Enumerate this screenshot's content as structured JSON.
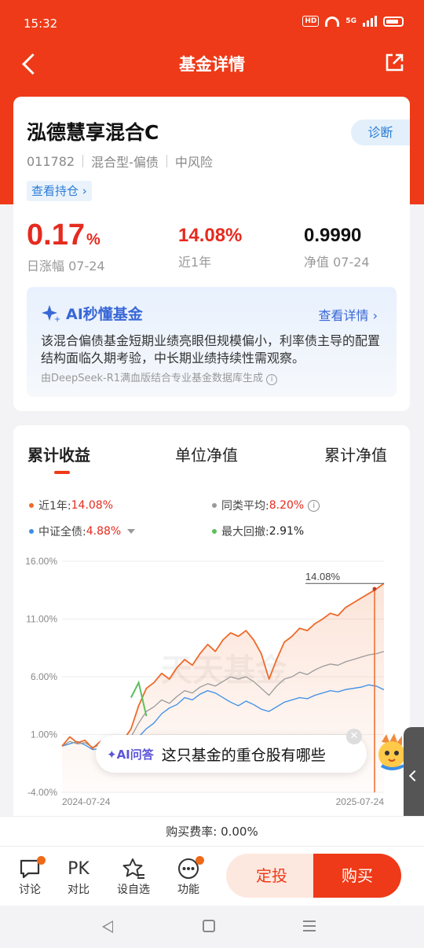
{
  "status": {
    "time": "15:32",
    "hd": "HD",
    "net": "5G"
  },
  "nav": {
    "title": "基金详情"
  },
  "fund": {
    "name": "泓德慧享混合C",
    "diagnose_label": "诊断",
    "code": "011782",
    "type": "混合型-偏债",
    "risk": "中风险",
    "holdings_label": "查看持仓 ›",
    "daily_change_value": "0.17",
    "daily_change_unit": "%",
    "daily_change_label": "日涨幅 07-24",
    "yearly_return_value": "14.08%",
    "yearly_return_label": "近1年",
    "nav_value": "0.9990",
    "nav_label": "净值 07-24"
  },
  "ai": {
    "title": "AI秒懂基金",
    "more_label": "查看详情",
    "text": "该混合偏债基金短期业绩亮眼但规模偏小，利率债主导的配置结构面临久期考验，中长期业绩持续性需观察。",
    "source": "由DeepSeek-R1满血版结合专业基金数据库生成"
  },
  "tabs": [
    "累计收益",
    "单位净值",
    "累计净值"
  ],
  "legend": [
    {
      "name": "近1年:",
      "value": "14.08%",
      "color": "#ee6a2a"
    },
    {
      "name": "同类平均:",
      "value": "8.20%",
      "color": "#999999"
    },
    {
      "name": "中证全债:",
      "value": "4.88%",
      "color": "#3a8ee6"
    },
    {
      "name": "最大回撤:",
      "value": "2.91%",
      "color": "#5cc05c"
    }
  ],
  "chart_data": {
    "type": "line",
    "x_start": "2024-07-24",
    "x_end": "2025-07-24",
    "y_ticks": [
      "16.00%",
      "11.00%",
      "6.00%",
      "1.00%",
      "-4.00%"
    ],
    "ylim": [
      -4,
      16
    ],
    "end_label": "14.08%",
    "watermark": "天天基金",
    "series": [
      {
        "name": "近1年",
        "color": "#ee6a2a",
        "values": [
          0.0,
          0.8,
          0.3,
          0.5,
          -0.2,
          0.4,
          0.1,
          -0.3,
          0.5,
          1.5,
          3.5,
          5.0,
          5.5,
          6.3,
          5.8,
          6.8,
          7.5,
          7.0,
          8.0,
          8.8,
          8.2,
          9.2,
          9.8,
          9.5,
          10.0,
          9.2,
          8.0,
          5.8,
          7.5,
          9.0,
          9.5,
          10.2,
          10.0,
          10.6,
          11.0,
          11.5,
          11.3,
          12.0,
          12.4,
          12.8,
          13.2,
          13.6,
          14.08
        ]
      },
      {
        "name": "同类平均",
        "color": "#9a9a9a",
        "values": [
          0.0,
          0.4,
          0.2,
          0.3,
          -0.1,
          0.1,
          0.0,
          -0.2,
          0.2,
          0.8,
          2.0,
          3.0,
          3.4,
          4.0,
          3.7,
          4.3,
          4.8,
          4.6,
          5.1,
          5.4,
          5.2,
          5.6,
          6.0,
          5.8,
          6.0,
          5.6,
          5.0,
          4.4,
          5.2,
          5.8,
          6.0,
          6.4,
          6.2,
          6.6,
          6.9,
          7.1,
          7.0,
          7.3,
          7.5,
          7.7,
          7.9,
          8.0,
          8.2
        ]
      },
      {
        "name": "中证全债",
        "color": "#3a8ee6",
        "values": [
          0.0,
          0.2,
          0.4,
          0.1,
          -0.3,
          -0.2,
          -0.1,
          -0.4,
          -0.1,
          0.3,
          0.8,
          1.5,
          2.0,
          2.8,
          3.3,
          3.6,
          4.2,
          4.0,
          4.5,
          4.8,
          4.6,
          4.2,
          3.8,
          3.5,
          3.9,
          3.6,
          3.2,
          3.0,
          3.4,
          3.8,
          4.0,
          4.2,
          4.1,
          4.4,
          4.6,
          4.8,
          4.7,
          4.9,
          5.0,
          5.1,
          5.3,
          5.2,
          4.88
        ]
      }
    ],
    "max_drawdown": {
      "name": "最大回撤",
      "color": "#5cc05c",
      "values": [
        4.2,
        5.5,
        2.6
      ]
    }
  },
  "ai_popup": {
    "badge": "✦AI问答",
    "text": "这只基金的重仓股有哪些",
    "close": "✕"
  },
  "fee": "购买费率: 0.00%",
  "bottom": {
    "items": [
      "讨论",
      "对比",
      "设自选",
      "功能"
    ],
    "pk": "PK",
    "dingtou": "定投",
    "buy": "购买"
  }
}
